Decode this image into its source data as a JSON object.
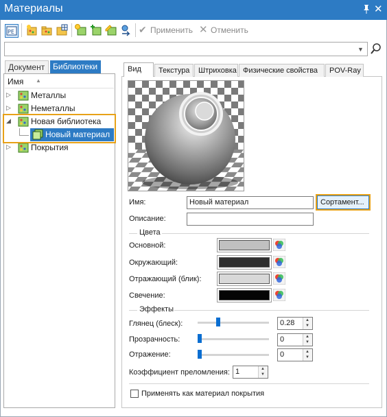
{
  "window": {
    "title": "Материалы"
  },
  "toolbar": {
    "apply_label": "Применить",
    "cancel_label": "Отменить",
    "icons": [
      "properties-icon",
      "new-library-icon",
      "open-library-icon",
      "library-grid-icon",
      "add-material-icon",
      "add-green-material-icon",
      "edit-material-icon",
      "link-material-icon",
      "check-icon",
      "x-icon"
    ]
  },
  "search": {
    "value": "",
    "placeholder": ""
  },
  "left_tabs": [
    {
      "label": "Документ",
      "active": false
    },
    {
      "label": "Библиотеки",
      "active": true
    }
  ],
  "tree": {
    "header": "Имя",
    "items": [
      {
        "label": "Металлы",
        "level": 0,
        "expanded": false
      },
      {
        "label": "Неметаллы",
        "level": 0,
        "expanded": false
      },
      {
        "label": "Новая библиотека",
        "level": 0,
        "expanded": true
      },
      {
        "label": "Новый материал",
        "level": 1,
        "selected": true
      },
      {
        "label": "Покрытия",
        "level": 0,
        "expanded": false
      }
    ]
  },
  "right_tabs": [
    {
      "label": "Вид",
      "active": true
    },
    {
      "label": "Текстура",
      "active": false
    },
    {
      "label": "Штриховка",
      "active": false
    },
    {
      "label": "Физические свойства",
      "active": false
    },
    {
      "label": "POV-Ray",
      "active": false
    }
  ],
  "form": {
    "name_label": "Имя:",
    "name_value": "Новый материал",
    "sortament_button": "Сортамент...",
    "description_label": "Описание:",
    "description_value": "",
    "colors_section": "Цвета",
    "colors": [
      {
        "label": "Основной:",
        "color": "#c0c0c0"
      },
      {
        "label": "Окружающий:",
        "color": "#2e2e2e"
      },
      {
        "label": "Отражающий (блик):",
        "color": "#d8d8d8"
      },
      {
        "label": "Свечение:",
        "color": "#050505"
      }
    ],
    "effects_section": "Эффекты",
    "effects": [
      {
        "label": "Глянец (блеск):",
        "value": "0.28",
        "fraction": 0.28
      },
      {
        "label": "Прозрачность:",
        "value": "0",
        "fraction": 0
      },
      {
        "label": "Отражение:",
        "value": "0",
        "fraction": 0
      }
    ],
    "refraction_label": "Коэффициент преломления:",
    "refraction_value": "1",
    "coating_checkbox_label": "Применять как материал покрытия",
    "coating_checked": false
  },
  "colors": {
    "accent": "#2d7bc4",
    "highlight": "#e7a117",
    "slider": "#0a6ed1"
  }
}
